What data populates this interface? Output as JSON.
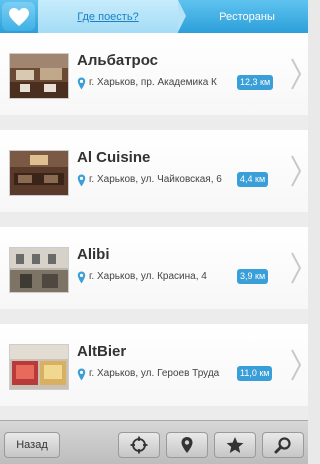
{
  "header": {
    "left_icon": "heart-icon",
    "tab_where": "Где поесть?",
    "tab_restaurants": "Рестораны"
  },
  "restaurants": [
    {
      "name": "Альбатрос",
      "address": "г. Харьков, пр. Академика К",
      "distance": "12,3 км"
    },
    {
      "name": "Al Cuisine",
      "address": "г. Харьков, ул. Чайковская, 6",
      "distance": "4,4 км"
    },
    {
      "name": "Alibi",
      "address": "г. Харьков, ул. Красина, 4",
      "distance": "3,9 км"
    },
    {
      "name": "AltBier",
      "address": "г. Харьков, ул. Героев Труда",
      "distance": "11,0 км"
    }
  ],
  "bottombar": {
    "back_label": "Назад",
    "icons": [
      "crosshair-icon",
      "map-pin-icon",
      "star-icon",
      "search-icon"
    ]
  },
  "colors": {
    "accent": "#3a9fd8",
    "header_blue": "#2c9fda"
  }
}
